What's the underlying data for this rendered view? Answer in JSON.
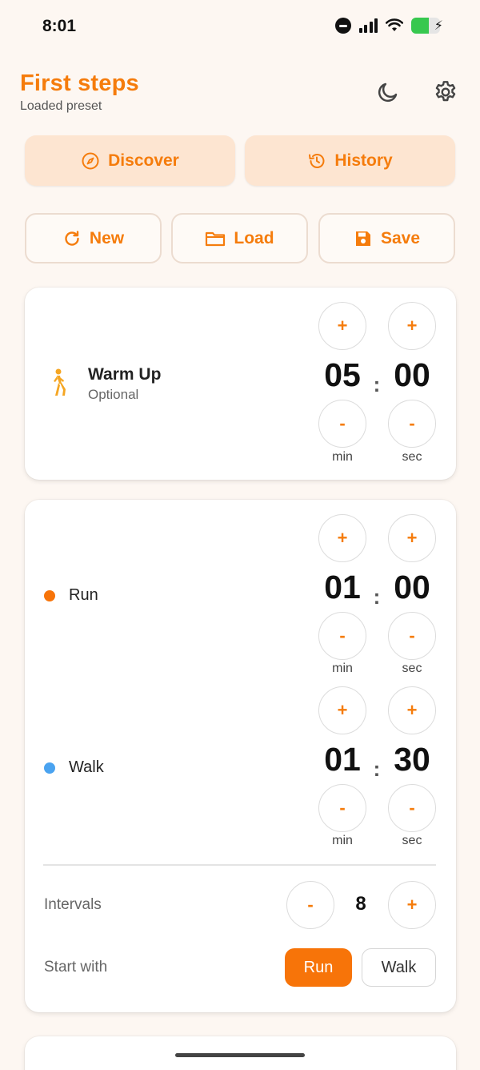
{
  "status_bar": {
    "time": "8:01"
  },
  "header": {
    "title": "First steps",
    "subtitle": "Loaded preset"
  },
  "tabs": {
    "discover": "Discover",
    "history": "History"
  },
  "actions": {
    "new": "New",
    "load": "Load",
    "save": "Save"
  },
  "warmup": {
    "title": "Warm Up",
    "subtitle": "Optional",
    "minutes": "05",
    "seconds": "00"
  },
  "segments": [
    {
      "label": "Run",
      "minutes": "01",
      "seconds": "00",
      "color": "#f77409"
    },
    {
      "label": "Walk",
      "minutes": "01",
      "seconds": "30",
      "color": "#4aa3f0"
    }
  ],
  "units": {
    "min": "min",
    "sec": "sec"
  },
  "controls": {
    "plus": "+",
    "minus": "-",
    "colon": ":"
  },
  "intervals": {
    "label": "Intervals",
    "value": "8"
  },
  "start_with": {
    "label": "Start with",
    "options": [
      "Run",
      "Walk"
    ],
    "selected": "Run"
  },
  "colors": {
    "accent": "#f57c0c",
    "background": "#fdf7f2",
    "tab_bg": "#fde5d1"
  }
}
